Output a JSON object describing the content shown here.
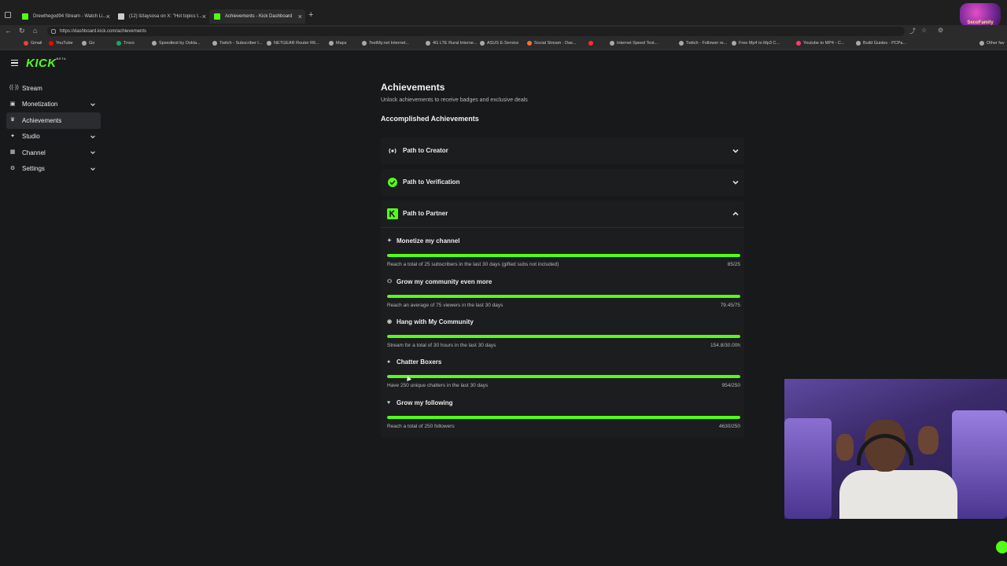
{
  "browser": {
    "tabs": [
      {
        "label": "Drewthegod94 Stream - Watch Li...",
        "icon": "kick-favicon",
        "color": "#53fc18"
      },
      {
        "label": "(12) lizlaysosa on X: \"Hot topics I...",
        "icon": "x-favicon",
        "color": "#cccccc"
      },
      {
        "label": "Achievements - Kick Dashboard",
        "icon": "kick-favicon",
        "color": "#53fc18",
        "active": true
      }
    ],
    "url": "https://dashboard.kick.com/achievements",
    "bookmarks": [
      "Gmail",
      "YouTube",
      "Go",
      "Trovo",
      "Speedtest by Ookla...",
      "Twitch - Subscriber I...",
      "NETGEAR Router R6...",
      "Maps",
      "TestMy.net Internet...",
      "4G LTE Rural Interne...",
      "ASUS E-Service",
      "Social Stream - Das...",
      "",
      "Internet Speed Test...",
      "Twitch - Follower re...",
      "Free Mp4 to Mp3 C...",
      "Youtube to MP4 - C...",
      "Build Guides - PCPa...",
      "Other fav"
    ],
    "profile_badge": "SecoFamily"
  },
  "app": {
    "logo": "KICK",
    "logo_tag": "BETA",
    "accent": "#53fc18"
  },
  "sidebar": {
    "items": [
      {
        "label": "Stream",
        "icon": "broadcast-icon",
        "has_chevron": false
      },
      {
        "label": "Monetization",
        "icon": "wallet-icon",
        "has_chevron": true
      },
      {
        "label": "Achievements",
        "icon": "trophy-icon",
        "has_chevron": false,
        "active": true
      },
      {
        "label": "Studio",
        "icon": "studio-icon",
        "has_chevron": true
      },
      {
        "label": "Channel",
        "icon": "channel-icon",
        "has_chevron": true
      },
      {
        "label": "Settings",
        "icon": "gear-icon",
        "has_chevron": true
      }
    ]
  },
  "page": {
    "title": "Achievements",
    "subtitle": "Unlock achievements to receive badges and exclusive deals",
    "section_title": "Accomplished Achievements"
  },
  "accordions": [
    {
      "label": "Path to Creator",
      "icon": "creator-icon",
      "expanded": false
    },
    {
      "label": "Path to Verification",
      "icon": "verified-icon",
      "expanded": false
    },
    {
      "label": "Path to Partner",
      "icon": "partner-icon",
      "expanded": true
    }
  ],
  "achievements": [
    {
      "title": "Monetize my channel",
      "icon": "sparkle-icon",
      "description": "Reach a total of 25 subscribers in the last 30 days (gifted subs not included)",
      "progress_text": "85/25",
      "progress": 1.0
    },
    {
      "title": "Grow my community even more",
      "icon": "community-icon",
      "description": "Reach an average of 75 viewers in the last 30 days",
      "progress_text": "79.45/75",
      "progress": 1.0
    },
    {
      "title": "Hang with My Community",
      "icon": "broadcast-icon",
      "description": "Stream for a total of 30 hours in the last 30 days",
      "progress_text": "154.8/30.00h",
      "progress": 1.0
    },
    {
      "title": "Chatter Boxers",
      "icon": "chat-icon",
      "description": "Have 250 unique chatters in the last 30 days",
      "progress_text": "954/250",
      "progress": 1.0
    },
    {
      "title": "Grow my following",
      "icon": "heart-icon",
      "description": "Reach a total of 250 followers",
      "progress_text": "4630/250",
      "progress": 1.0
    }
  ]
}
